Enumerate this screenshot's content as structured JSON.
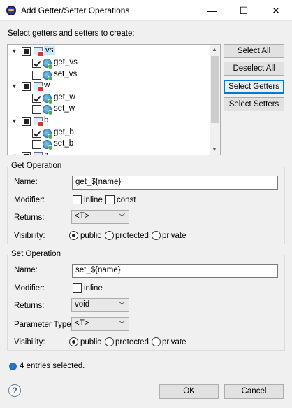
{
  "window": {
    "title": "Add Getter/Setter Operations",
    "minimize": "—",
    "maximize": "☐",
    "close": "✕"
  },
  "prompt": "Select getters and setters to create:",
  "tree": [
    {
      "label": "vs",
      "kind": "field",
      "state": "partial",
      "expanded": true,
      "selected": true
    },
    {
      "label": "get_vs",
      "kind": "method",
      "checked": true
    },
    {
      "label": "set_vs",
      "kind": "method",
      "checked": false
    },
    {
      "label": "w",
      "kind": "field",
      "state": "partial",
      "expanded": true
    },
    {
      "label": "get_w",
      "kind": "method",
      "checked": true
    },
    {
      "label": "set_w",
      "kind": "method",
      "checked": false
    },
    {
      "label": "b",
      "kind": "field",
      "state": "partial",
      "expanded": true
    },
    {
      "label": "get_b",
      "kind": "method",
      "checked": true
    },
    {
      "label": "set_b",
      "kind": "method",
      "checked": false
    },
    {
      "label": "a",
      "kind": "field",
      "state": "partial",
      "expanded": true
    }
  ],
  "buttons": {
    "select_all": "Select All",
    "deselect_all": "Deselect All",
    "select_getters": "Select Getters",
    "select_setters": "Select Setters",
    "ok": "OK",
    "cancel": "Cancel"
  },
  "get_op": {
    "title": "Get Operation",
    "name_label": "Name:",
    "name_value": "get_${name}",
    "modifier_label": "Modifier:",
    "inline": "inline",
    "inline_checked": false,
    "const": "const",
    "const_checked": false,
    "returns_label": "Returns:",
    "returns_value": "<T>",
    "visibility_label": "Visibility:",
    "public": "public",
    "protected": "protected",
    "private": "private",
    "visibility_selected": "public"
  },
  "set_op": {
    "title": "Set Operation",
    "name_label": "Name:",
    "name_value": "set_${name}",
    "modifier_label": "Modifier:",
    "inline": "inline",
    "inline_checked": false,
    "returns_label": "Returns:",
    "returns_value": "void",
    "param_type_label": "Parameter Type:",
    "param_type_value": "<T>",
    "visibility_label": "Visibility:",
    "public": "public",
    "protected": "protected",
    "private": "private",
    "visibility_selected": "public"
  },
  "status": "4 entries selected.",
  "colors": {
    "accent": "#0078d7",
    "tree_selection": "#cce8ff"
  }
}
